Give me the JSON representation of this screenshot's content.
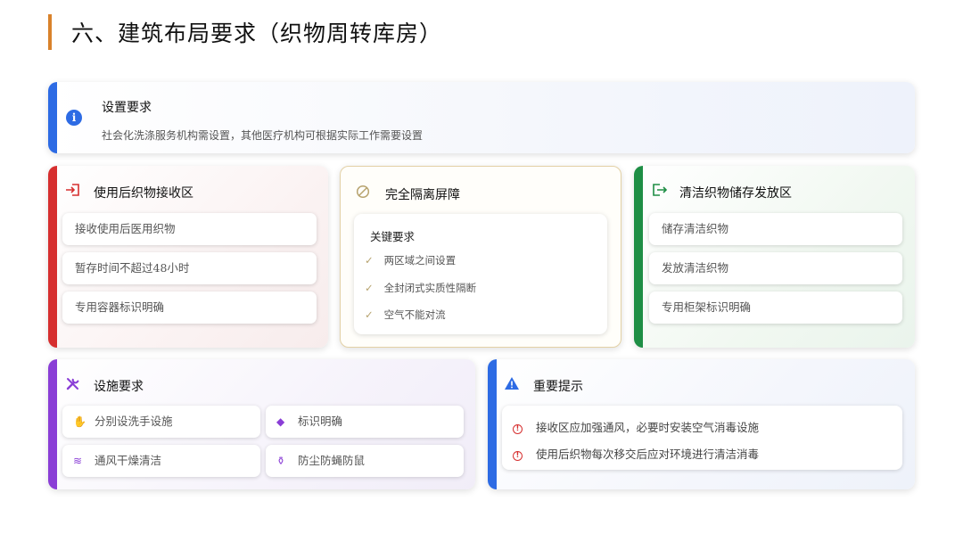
{
  "page": {
    "title": "六、建筑布局要求（织物周转库房）"
  },
  "banner": {
    "icon": "info-icon",
    "title": "设置要求",
    "subtitle": "社会化洗涤服务机构需设置，其他医疗机构可根据实际工作需要设置",
    "accent_color": "#2d6be4"
  },
  "receive_zone": {
    "icon": "login-arrow-icon",
    "title": "使用后织物接收区",
    "accent_color": "#d62f2f",
    "items": [
      "接收使用后医用织物",
      "暂存时间不超过48小时",
      "专用容器标识明确"
    ]
  },
  "isolation": {
    "icon": "prohibit-icon",
    "title": "完全隔离屏障",
    "box_title": "关键要求",
    "border_color": "#e3d1a6",
    "items": [
      "两区域之间设置",
      "全封闭式实质性隔断",
      "空气不能对流"
    ]
  },
  "clean_zone": {
    "icon": "logout-arrow-icon",
    "title": "清洁织物储存发放区",
    "accent_color": "#1e8e45",
    "items": [
      "储存清洁织物",
      "发放清洁织物",
      "专用柜架标识明确"
    ]
  },
  "facilities": {
    "icon": "tools-icon",
    "title": "设施要求",
    "accent_color": "#8a3ed6",
    "items": [
      {
        "icon": "hand-wash-icon",
        "label": "分别设洗手设施"
      },
      {
        "icon": "tag-icon",
        "label": "标识明确"
      },
      {
        "icon": "wind-icon",
        "label": "通风干燥清洁"
      },
      {
        "icon": "broom-icon",
        "label": "防尘防蝇防鼠"
      }
    ]
  },
  "tips": {
    "icon": "warning-triangle-icon",
    "title": "重要提示",
    "accent_color": "#2d6be4",
    "items": [
      "接收区应加强通风，必要时安装空气消毒设施",
      "使用后织物每次移交后应对环境进行清洁消毒"
    ]
  }
}
